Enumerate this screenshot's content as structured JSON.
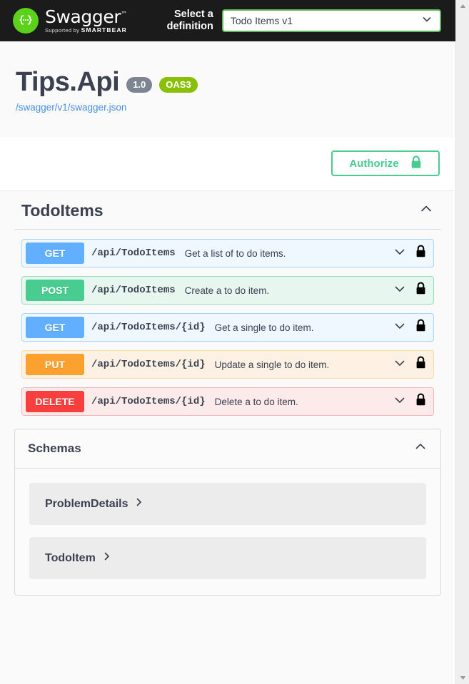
{
  "topbar": {
    "logo_word": "Swagger",
    "logo_tm": "™",
    "logo_supported_prefix": "Supported by ",
    "logo_brand": "SMARTBEAR",
    "select_label": "Select a definition",
    "definition_selected": "Todo Items v1",
    "definition_options": [
      "Todo Items v1"
    ]
  },
  "info": {
    "title": "Tips.Api",
    "version_badge": "1.0",
    "oas_badge": "OAS3",
    "spec_url": "/swagger/v1/swagger.json"
  },
  "authorize": {
    "label": "Authorize"
  },
  "tag": {
    "name": "TodoItems",
    "expanded": true,
    "operations": [
      {
        "method": "GET",
        "path": "/api/TodoItems",
        "summary": "Get a list of to do items.",
        "locked": true
      },
      {
        "method": "POST",
        "path": "/api/TodoItems",
        "summary": "Create a to do item.",
        "locked": true
      },
      {
        "method": "GET",
        "path": "/api/TodoItems/{id}",
        "summary": "Get a single to do item.",
        "locked": true
      },
      {
        "method": "PUT",
        "path": "/api/TodoItems/{id}",
        "summary": "Update a single to do item.",
        "locked": true
      },
      {
        "method": "DELETE",
        "path": "/api/TodoItems/{id}",
        "summary": "Delete a to do item.",
        "locked": true
      }
    ]
  },
  "schemas": {
    "title": "Schemas",
    "expanded": true,
    "models": [
      {
        "name": "ProblemDetails"
      },
      {
        "name": "TodoItem"
      }
    ]
  },
  "colors": {
    "topbar_bg": "#1b1b1b",
    "logo_green": "#5bd11a",
    "select_border": "#5bb85b",
    "authorize_green": "#49cc90",
    "link_blue": "#4990e2",
    "version_badge_gray": "#7d8492",
    "oas_badge_green": "#89bf04",
    "get_blue": "#61affe",
    "post_green": "#49cc90",
    "put_orange": "#fca130",
    "delete_red": "#f93e3e",
    "text_dark": "#3b4151"
  }
}
